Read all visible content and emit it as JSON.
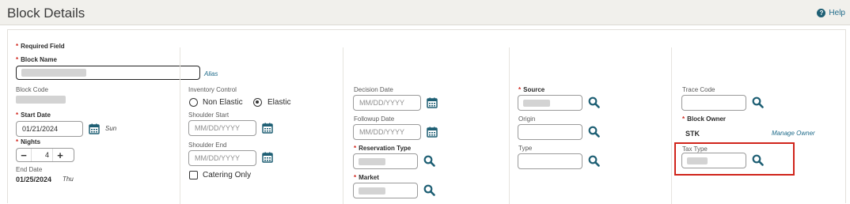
{
  "header": {
    "title": "Block Details",
    "help_label": "Help"
  },
  "required_field": "Required Field",
  "block_name": {
    "label": "Block Name",
    "alias_link": "Alias"
  },
  "block_code": {
    "label": "Block Code"
  },
  "start_date": {
    "label": "Start Date",
    "value": "01/21/2024",
    "day": "Sun"
  },
  "nights": {
    "label": "Nights",
    "value": "4",
    "minus": "−",
    "plus": "+"
  },
  "end_date": {
    "label": "End Date",
    "value": "01/25/2024",
    "day": "Thu"
  },
  "inventory_control": {
    "label": "Inventory Control",
    "options": [
      "Non Elastic",
      "Elastic"
    ],
    "selected": "Elastic"
  },
  "shoulder_start": {
    "label": "Shoulder Start",
    "placeholder": "MM/DD/YYYY"
  },
  "shoulder_end": {
    "label": "Shoulder End",
    "placeholder": "MM/DD/YYYY"
  },
  "catering_only": {
    "label": "Catering Only"
  },
  "decision_date": {
    "label": "Decision Date",
    "placeholder": "MM/DD/YYYY"
  },
  "followup_date": {
    "label": "Followup Date",
    "placeholder": "MM/DD/YYYY"
  },
  "reservation_type": {
    "label": "Reservation Type"
  },
  "market": {
    "label": "Market"
  },
  "source": {
    "label": "Source"
  },
  "origin": {
    "label": "Origin"
  },
  "type": {
    "label": "Type"
  },
  "trace_code": {
    "label": "Trace Code"
  },
  "block_owner": {
    "label": "Block Owner",
    "value": "STK",
    "manage_link": "Manage Owner"
  },
  "tax_type": {
    "label": "Tax Type"
  },
  "colors": {
    "accent": "#1e5f74",
    "required": "#d0241b",
    "highlight": "#d0241b"
  }
}
